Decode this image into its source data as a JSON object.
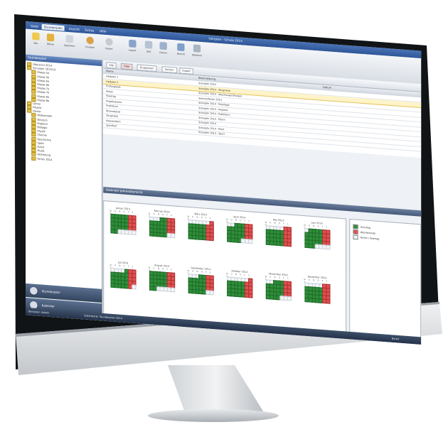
{
  "window": {
    "title": "Fahrplan - Schule 2014",
    "ribbon_tabs": [
      "Datei",
      "Stundenplan",
      "Ansicht",
      "Extras",
      "Hilfe"
    ],
    "ribbon_buttons": [
      "Neu",
      "Öffnen",
      "Speichern",
      "Drucken",
      "Export",
      "Import",
      "Zeit",
      "Datum",
      "Bericht",
      "Optionen"
    ]
  },
  "left_panel": {
    "header": "Stundenplan",
    "tree_items": [
      "Übersicht 2014",
      "Schuljahr 2013/14",
      "Klasse 5a",
      "Klasse 5b",
      "Klasse 6a",
      "Klasse 6b",
      "Klasse 7a",
      "Klasse 7b",
      "Klasse 8a",
      "Klasse 8b",
      "Lehrer",
      "Räume",
      "Fächer",
      "Mathematik",
      "Deutsch",
      "Englisch",
      "Biologie",
      "Physik",
      "Chemie",
      "Geschichte",
      "Sport",
      "Kunst",
      "Musik",
      "Vertretung",
      "Ferien 2014"
    ],
    "nav_buttons": [
      "Stundenplan",
      "Kalender"
    ]
  },
  "main": {
    "toolbar_chips": [
      "Alle",
      "Filter",
      "Gruppieren",
      "Suchen",
      "Export"
    ],
    "grid_headers": [
      "Name",
      "Beschreibung",
      "Datum"
    ],
    "grid_rows": [
      {
        "name": "Halbjahr 1",
        "desc": "Schuljahr 2014",
        "date": ""
      },
      {
        "name": "Halbjahr 2",
        "desc": "Schuljahr 2014 - Zeugnisse",
        "date": ""
      },
      {
        "name": "Prüfungszeit",
        "desc": "Schuljahr 2014 - Abschlussprüfungen",
        "date": ""
      },
      {
        "name": "Ferien",
        "desc": "Sommerferien 2014",
        "date": ""
      },
      {
        "name": "Feiertag",
        "desc": "Schuljahr 2014 - Feiertage",
        "date": ""
      },
      {
        "name": "Projektwoche",
        "desc": "Schuljahr 2014 - Projekte",
        "date": ""
      },
      {
        "name": "Praktikum",
        "desc": "Schuljahr 2014 - Praktikum",
        "date": ""
      },
      {
        "name": "Elternabend",
        "desc": "Schuljahr 2014 - Eltern",
        "date": ""
      },
      {
        "name": "Zeugnisse",
        "desc": "Schuljahr 2014",
        "date": ""
      },
      {
        "name": "Klassenfahrt",
        "desc": "Schuljahr 2014 - Fahrt",
        "date": ""
      },
      {
        "name": "Sportfest",
        "desc": "Schuljahr 2014 - Sport",
        "date": ""
      }
    ],
    "selected_row": 1,
    "section_title": "Kalender Jahresübersicht",
    "months": [
      "Januar 2014",
      "Februar 2014",
      "März 2014",
      "April 2014",
      "Mai 2014",
      "Juni 2014",
      "Juli 2014",
      "August 2014",
      "September 2014",
      "Oktober 2014",
      "November 2014",
      "Dezember 2014"
    ],
    "weekdays": "M D M D F S S",
    "legend": [
      {
        "label": "Schultag",
        "color": "#2f8f3a"
      },
      {
        "label": "Wochenende",
        "color": "#e35050"
      },
      {
        "label": "Ferien / Feiertag",
        "color": "#f4f6f8"
      }
    ]
  },
  "status": {
    "left": "Benutzer: Admin",
    "mid": "Datenbank: Stundenplan 2014",
    "right": "Bereit"
  },
  "colors": {
    "accent": "#2d5598",
    "workday": "#2f8f3a",
    "weekend": "#e35050"
  }
}
